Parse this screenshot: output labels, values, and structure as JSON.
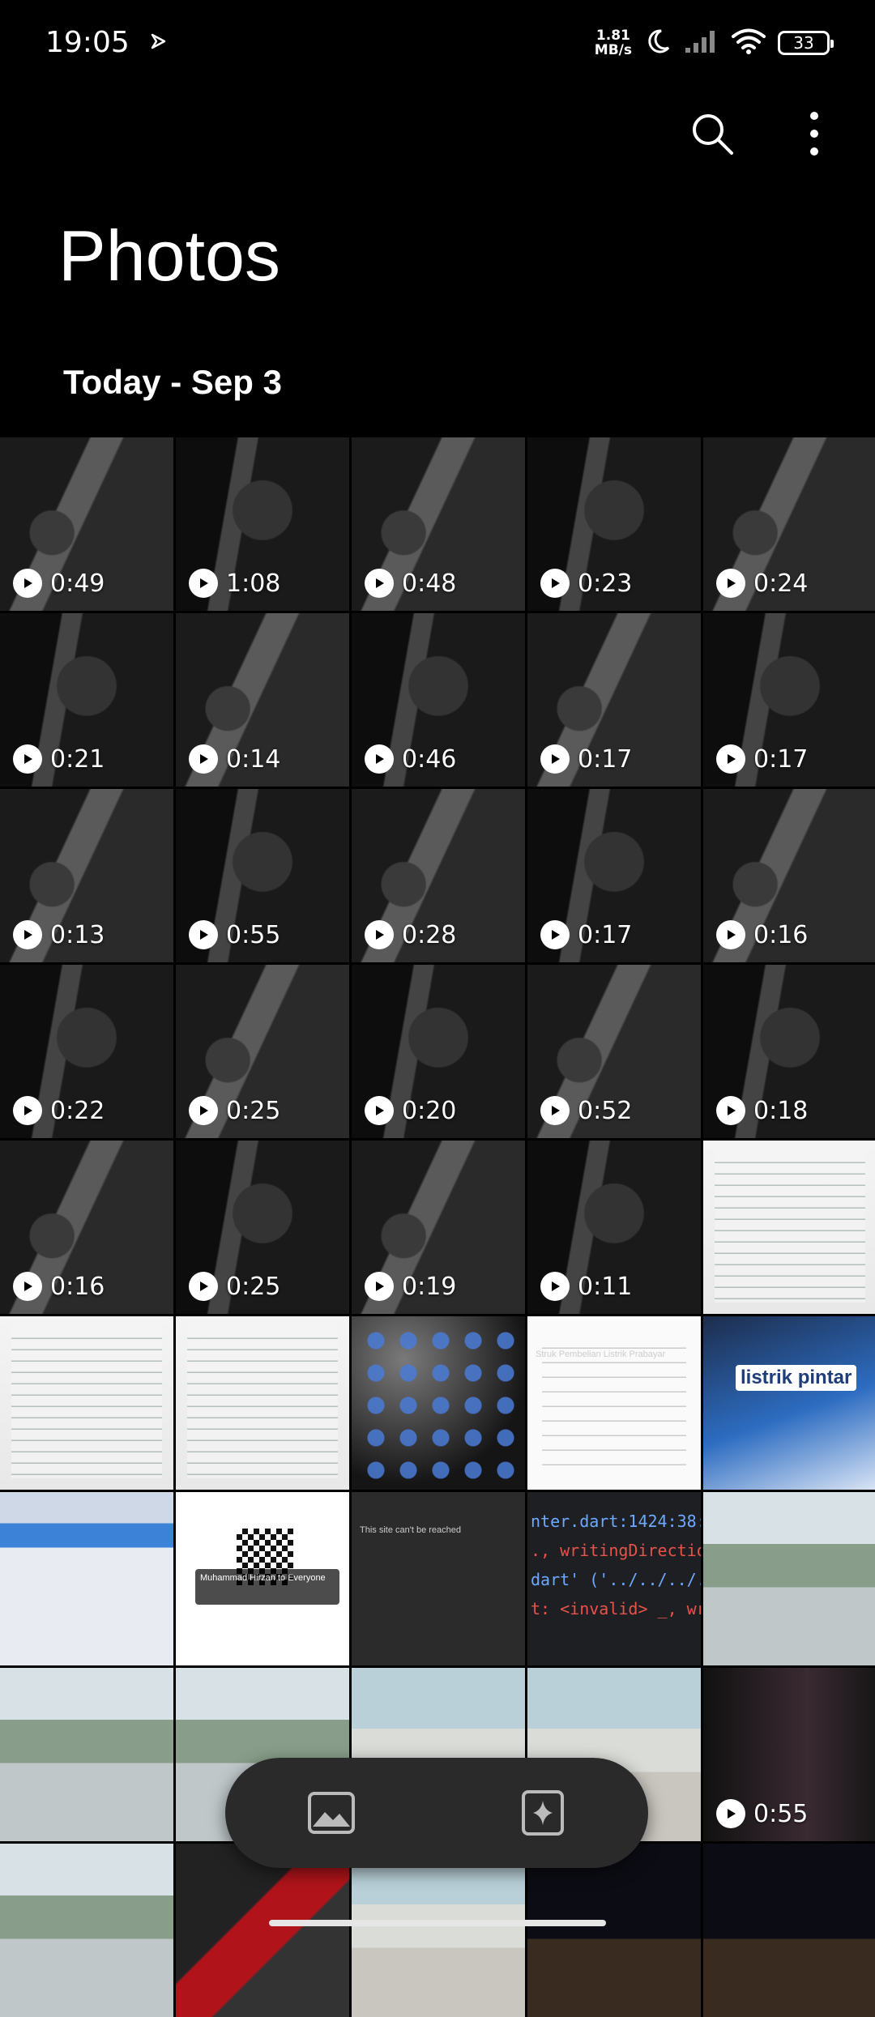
{
  "status_bar": {
    "time": "19:05",
    "net_speed_value": "1.81",
    "net_speed_unit": "MB/s",
    "battery": "33"
  },
  "header": {
    "title": "Photos",
    "section_date": "Today - Sep 3"
  },
  "grid": {
    "tiles": [
      {
        "kind": "video",
        "duration": "0:49"
      },
      {
        "kind": "video",
        "duration": "1:08"
      },
      {
        "kind": "video",
        "duration": "0:48"
      },
      {
        "kind": "video",
        "duration": "0:23"
      },
      {
        "kind": "video",
        "duration": "0:24"
      },
      {
        "kind": "video",
        "duration": "0:21"
      },
      {
        "kind": "video",
        "duration": "0:14"
      },
      {
        "kind": "video",
        "duration": "0:46"
      },
      {
        "kind": "video",
        "duration": "0:17"
      },
      {
        "kind": "video",
        "duration": "0:17"
      },
      {
        "kind": "video",
        "duration": "0:13"
      },
      {
        "kind": "video",
        "duration": "0:55"
      },
      {
        "kind": "video",
        "duration": "0:28"
      },
      {
        "kind": "video",
        "duration": "0:17"
      },
      {
        "kind": "video",
        "duration": "0:16"
      },
      {
        "kind": "video",
        "duration": "0:22"
      },
      {
        "kind": "video",
        "duration": "0:25"
      },
      {
        "kind": "video",
        "duration": "0:20"
      },
      {
        "kind": "video",
        "duration": "0:52"
      },
      {
        "kind": "video",
        "duration": "0:18"
      },
      {
        "kind": "video",
        "duration": "0:16"
      },
      {
        "kind": "video",
        "duration": "0:25"
      },
      {
        "kind": "video",
        "duration": "0:19"
      },
      {
        "kind": "video",
        "duration": "0:11"
      },
      {
        "kind": "photo",
        "style": "doc"
      },
      {
        "kind": "photo",
        "style": "doc"
      },
      {
        "kind": "photo",
        "style": "doc"
      },
      {
        "kind": "photo",
        "style": "apps"
      },
      {
        "kind": "photo",
        "style": "receipt",
        "text": "Struk Pembelian Listrik Prabayar"
      },
      {
        "kind": "photo",
        "style": "card",
        "text": "listrik pintar"
      },
      {
        "kind": "photo",
        "style": "screen-blue"
      },
      {
        "kind": "photo",
        "style": "qr",
        "text": "Muhammad Hirzan to Everyone"
      },
      {
        "kind": "photo",
        "style": "error",
        "text": "This site can't be reached"
      },
      {
        "kind": "photo",
        "style": "code",
        "code_lines": [
          "nter.dart:1424:38: ",
          "., writingDirection",
          "dart' ('../../../..",
          "t: <invalid> _, wri"
        ]
      },
      {
        "kind": "photo",
        "style": "aerial"
      },
      {
        "kind": "photo",
        "style": "aerial"
      },
      {
        "kind": "photo",
        "style": "aerial"
      },
      {
        "kind": "photo",
        "style": "room"
      },
      {
        "kind": "photo",
        "style": "room"
      },
      {
        "kind": "video",
        "style": "dark",
        "duration": "0:55"
      },
      {
        "kind": "photo",
        "style": "aerial"
      },
      {
        "kind": "photo",
        "style": "bike"
      },
      {
        "kind": "photo",
        "style": "room"
      },
      {
        "kind": "photo",
        "style": "night"
      },
      {
        "kind": "photo",
        "style": "night"
      }
    ]
  },
  "bottom_nav": {
    "items": [
      {
        "name": "photos",
        "icon": "image-icon"
      },
      {
        "name": "collections",
        "icon": "sparkle-icon"
      }
    ]
  },
  "colors": {
    "background": "#000000",
    "pill": "#2a2a2a",
    "text": "#ffffff"
  }
}
